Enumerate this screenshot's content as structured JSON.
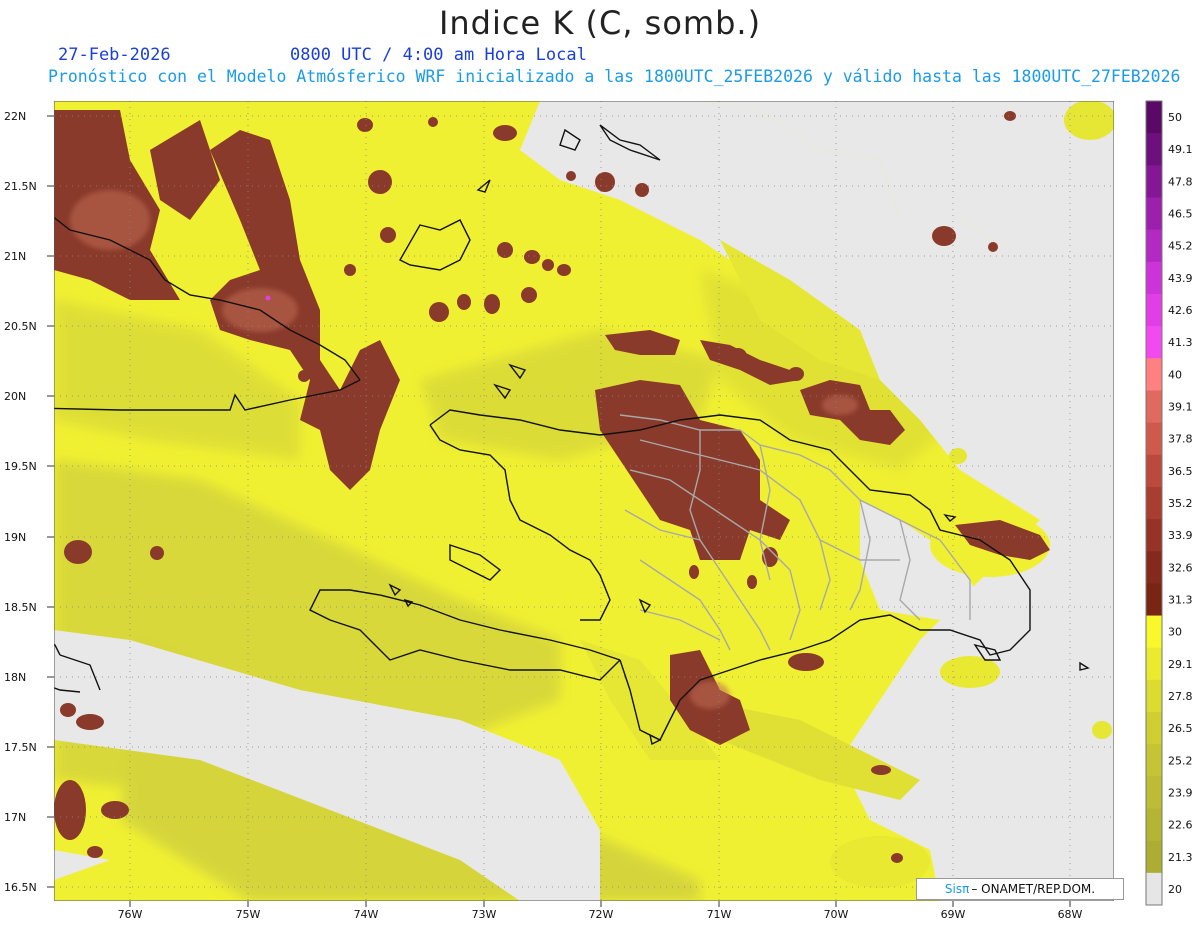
{
  "header": {
    "title": "Indice K (C, somb.)",
    "date": "27-Feb-2026",
    "time": "0800 UTC / 4:00 am Hora Local",
    "model_line": "Pronóstico con el Modelo Atmósferico WRF inicializado a las 1800UTC_25FEB2026 y válido hasta las  1800UTC_27FEB2026"
  },
  "map": {
    "lat_labels": [
      "22N",
      "21.5N",
      "21N",
      "20.5N",
      "20N",
      "19.5N",
      "19N",
      "18.5N",
      "18N",
      "17.5N",
      "17N",
      "16.5N"
    ],
    "lon_labels": [
      "76W",
      "75W",
      "74W",
      "73W",
      "72W",
      "71W",
      "70W",
      "69W",
      "68W"
    ]
  },
  "colorbar": {
    "labels": [
      "50",
      "49.1",
      "47.8",
      "46.5",
      "45.2",
      "43.9",
      "42.6",
      "41.3",
      "40",
      "39.1",
      "37.8",
      "36.5",
      "35.2",
      "33.9",
      "32.6",
      "31.3",
      "30",
      "29.1",
      "27.8",
      "26.5",
      "25.2",
      "23.9",
      "22.6",
      "21.3",
      "20"
    ],
    "colors": [
      "#5a0a66",
      "#6e0f7e",
      "#851796",
      "#9c1fae",
      "#b429c4",
      "#cc33d9",
      "#e13ee8",
      "#f24af0",
      "#ff8080",
      "#e06a5e",
      "#cf5a4c",
      "#bc4a3c",
      "#a93d30",
      "#963326",
      "#86291d",
      "#7a2414",
      "#f8f82a",
      "#eaea2e",
      "#dcdc30",
      "#cfcf32",
      "#c4c434",
      "#bcbc35",
      "#b5b534",
      "#adad32",
      "#e6e6e6"
    ],
    "icon": "vertical-color-scale"
  },
  "credit": {
    "brand": "Sisπ",
    "text": "– ONAMET/REP.DOM."
  },
  "colors": {
    "no_data": "#e8e8e8",
    "low_k": "#f0f032",
    "mid_k": "#d9d93a",
    "high_k": "#8a3a2a",
    "coast": "#111111",
    "borders": "#a0a0a0"
  }
}
